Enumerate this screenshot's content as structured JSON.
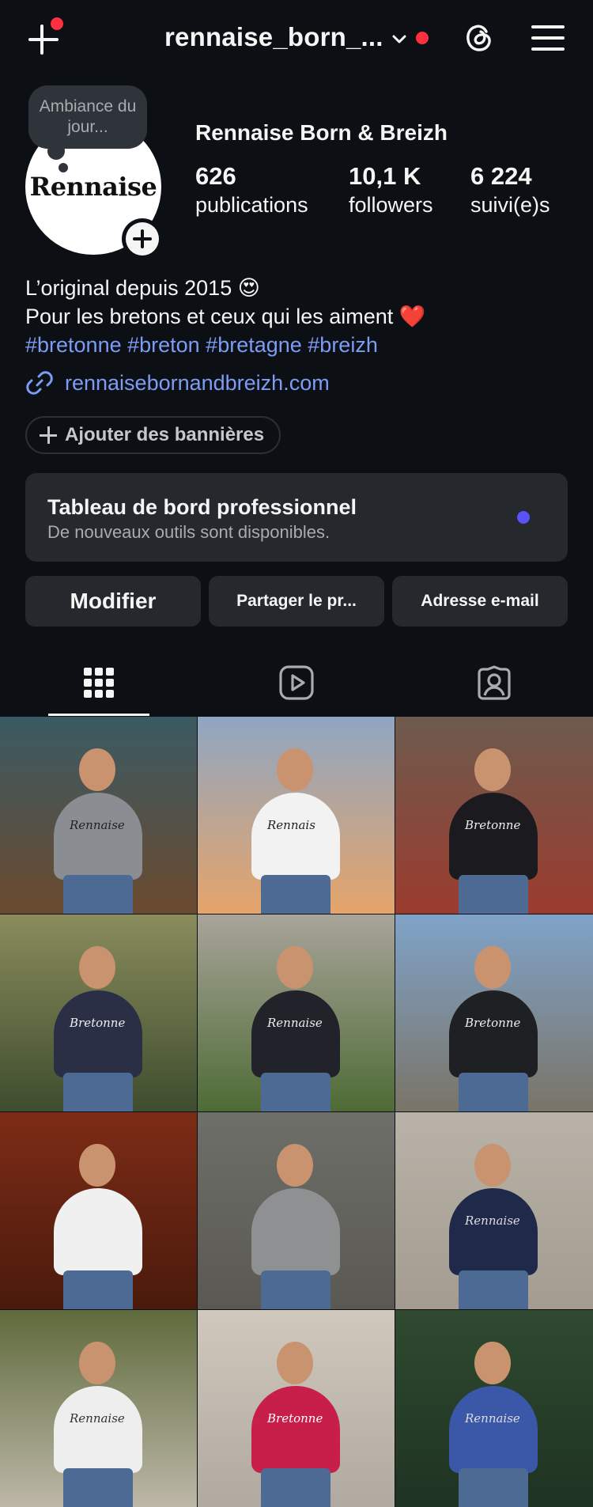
{
  "header": {
    "username": "rennaise_born_...",
    "icons": [
      "new-post-icon",
      "chevron-down-icon",
      "threads-icon",
      "menu-icon"
    ]
  },
  "profile": {
    "note": "Ambiance du jour...",
    "avatar_logo": "Rennaise",
    "display_name": "Rennaise Born & Breizh",
    "stats": [
      {
        "value": "626",
        "label": "publications"
      },
      {
        "value": "10,1 K",
        "label": "followers"
      },
      {
        "value": "6 224",
        "label": "suivi(e)s"
      }
    ]
  },
  "bio": {
    "line1": "L’original depuis 2015 😍",
    "line2": "Pour les bretons et ceux qui les aiment ❤️",
    "hashtags": "#bretonne #breton #bretagne #breizh",
    "link": "rennaisebornandbreizh.com"
  },
  "banner_button": "Ajouter des bannières",
  "dashboard": {
    "title": "Tableau de bord professionnel",
    "subtitle": "De nouveaux outils sont disponibles."
  },
  "actions": {
    "edit": "Modifier",
    "share": "Partager le pr...",
    "email": "Adresse e-mail"
  },
  "tabs": [
    "grid-icon",
    "reels-icon",
    "tagged-icon"
  ],
  "grid_tiles": [
    {
      "shirt": "Rennaise",
      "bg": [
        "#3b5a63",
        "#6b4a2f"
      ]
    },
    {
      "shirt": "Rennais",
      "bg": [
        "#8fa6c2",
        "#e6a46a"
      ]
    },
    {
      "shirt": "Bretonne",
      "bg": [
        "#6d5b4e",
        "#9b3b2e"
      ]
    },
    {
      "shirt": "Bretonne",
      "bg": [
        "#8a8c5c",
        "#3e4d2e"
      ]
    },
    {
      "shirt": "Rennaise",
      "bg": [
        "#a8a49a",
        "#4e6b35"
      ]
    },
    {
      "shirt": "Bretonne",
      "bg": [
        "#7fa3c8",
        "#7a7468"
      ]
    },
    {
      "shirt": "",
      "bg": [
        "#7d2c16",
        "#4a1a0c"
      ]
    },
    {
      "shirt": "",
      "bg": [
        "#6e6f6a",
        "#5a5852"
      ]
    },
    {
      "shirt": "Rennaise",
      "bg": [
        "#b8b2a8",
        "#a49c90"
      ]
    },
    {
      "shirt": "Rennaise",
      "bg": [
        "#5f6b3c",
        "#bdb7a8"
      ]
    },
    {
      "shirt": "Bretonne",
      "bg": [
        "#d0c8bd",
        "#b0a99f"
      ]
    },
    {
      "shirt": "Rennaise",
      "bg": [
        "#2f4a30",
        "#1e3322"
      ]
    }
  ]
}
